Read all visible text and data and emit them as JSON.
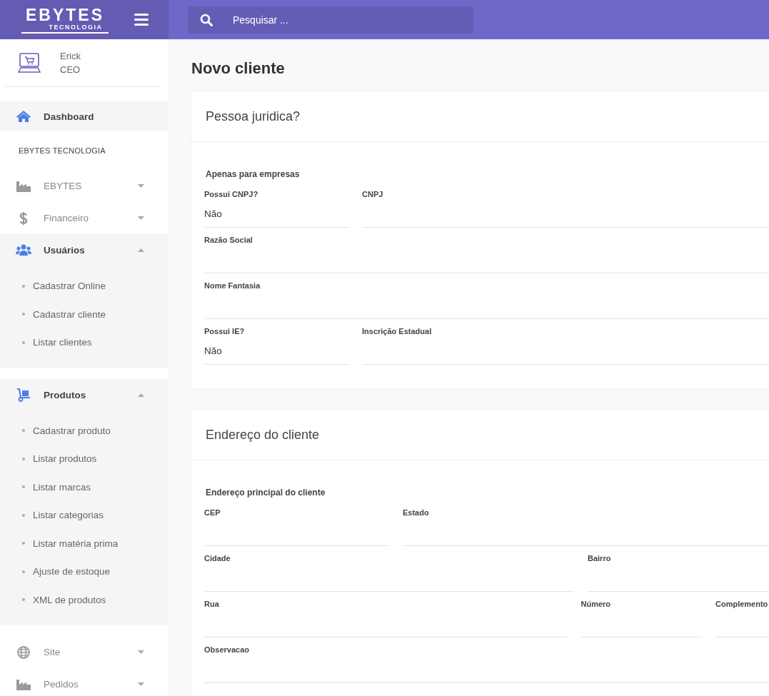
{
  "topbar": {
    "logo": {
      "title": "EBYTES",
      "subtitle": "TECNOLOGIA"
    },
    "search": {
      "placeholder": "Pesquisar ..."
    }
  },
  "profile": {
    "name": "Erick",
    "role": "CEO"
  },
  "sidebar": {
    "items": [
      {
        "kind": "link",
        "label": "Dashboard",
        "selected": true
      },
      {
        "kind": "header",
        "label": "EBYTES TECNOLOGIA"
      },
      {
        "kind": "group",
        "label": "EBYTES",
        "selected": false,
        "expanded": false
      },
      {
        "kind": "group",
        "label": "Financeiro",
        "selected": false,
        "expanded": false
      },
      {
        "kind": "group",
        "label": "Usuários",
        "selected": false,
        "expanded": true,
        "children": [
          {
            "label": "Cadastrar Online",
            "selected": false
          },
          {
            "label": "Cadastrar cliente",
            "selected": false
          },
          {
            "label": "Listar clientes",
            "selected": false
          }
        ]
      },
      {
        "kind": "group",
        "label": "Produtos",
        "selected": false,
        "expanded": true,
        "children": [
          {
            "label": "Cadastrar produto",
            "selected": false
          },
          {
            "label": "Listar produtos",
            "selected": false
          },
          {
            "label": "Listar marcas",
            "selected": false
          },
          {
            "label": "Listar categorias",
            "selected": false
          },
          {
            "label": "Listar matéria prima",
            "selected": false
          },
          {
            "label": "Ajuste de estoque",
            "selected": false
          },
          {
            "label": "XML de produtos",
            "selected": false
          }
        ]
      },
      {
        "kind": "group",
        "label": "Site",
        "selected": false,
        "expanded": false
      },
      {
        "kind": "group",
        "label": "Pedidos",
        "selected": false,
        "expanded": false
      }
    ]
  },
  "page": {
    "title": "Novo cliente",
    "cards": [
      {
        "title": "Pessoa juridica?",
        "subtitle": "Apenas para empresas",
        "rows": [
          [
            {
              "label": "Possui CNPJ?",
              "value": "Não"
            },
            {
              "label": "CNPJ"
            }
          ],
          [
            {
              "label": "Razão Social"
            }
          ],
          [
            {
              "label": "Nome Fantasia"
            }
          ],
          [
            {
              "label": "Possui IE?",
              "value": "Não"
            },
            {
              "label": "Inscrição Estadual"
            }
          ]
        ]
      },
      {
        "title": "Endereço do cliente",
        "subtitle": "Endereço principal do cliente",
        "rows": [
          [
            {
              "label": "CEP"
            },
            {
              "label": "Estado"
            }
          ],
          [
            {
              "label": "Cidade"
            },
            {
              "label": "Bairro"
            }
          ],
          [
            {
              "label": "Rua"
            },
            {
              "label": "Número"
            },
            {
              "label": "Complemento"
            }
          ],
          [
            {
              "label": "Observacao"
            }
          ]
        ]
      }
    ]
  }
}
